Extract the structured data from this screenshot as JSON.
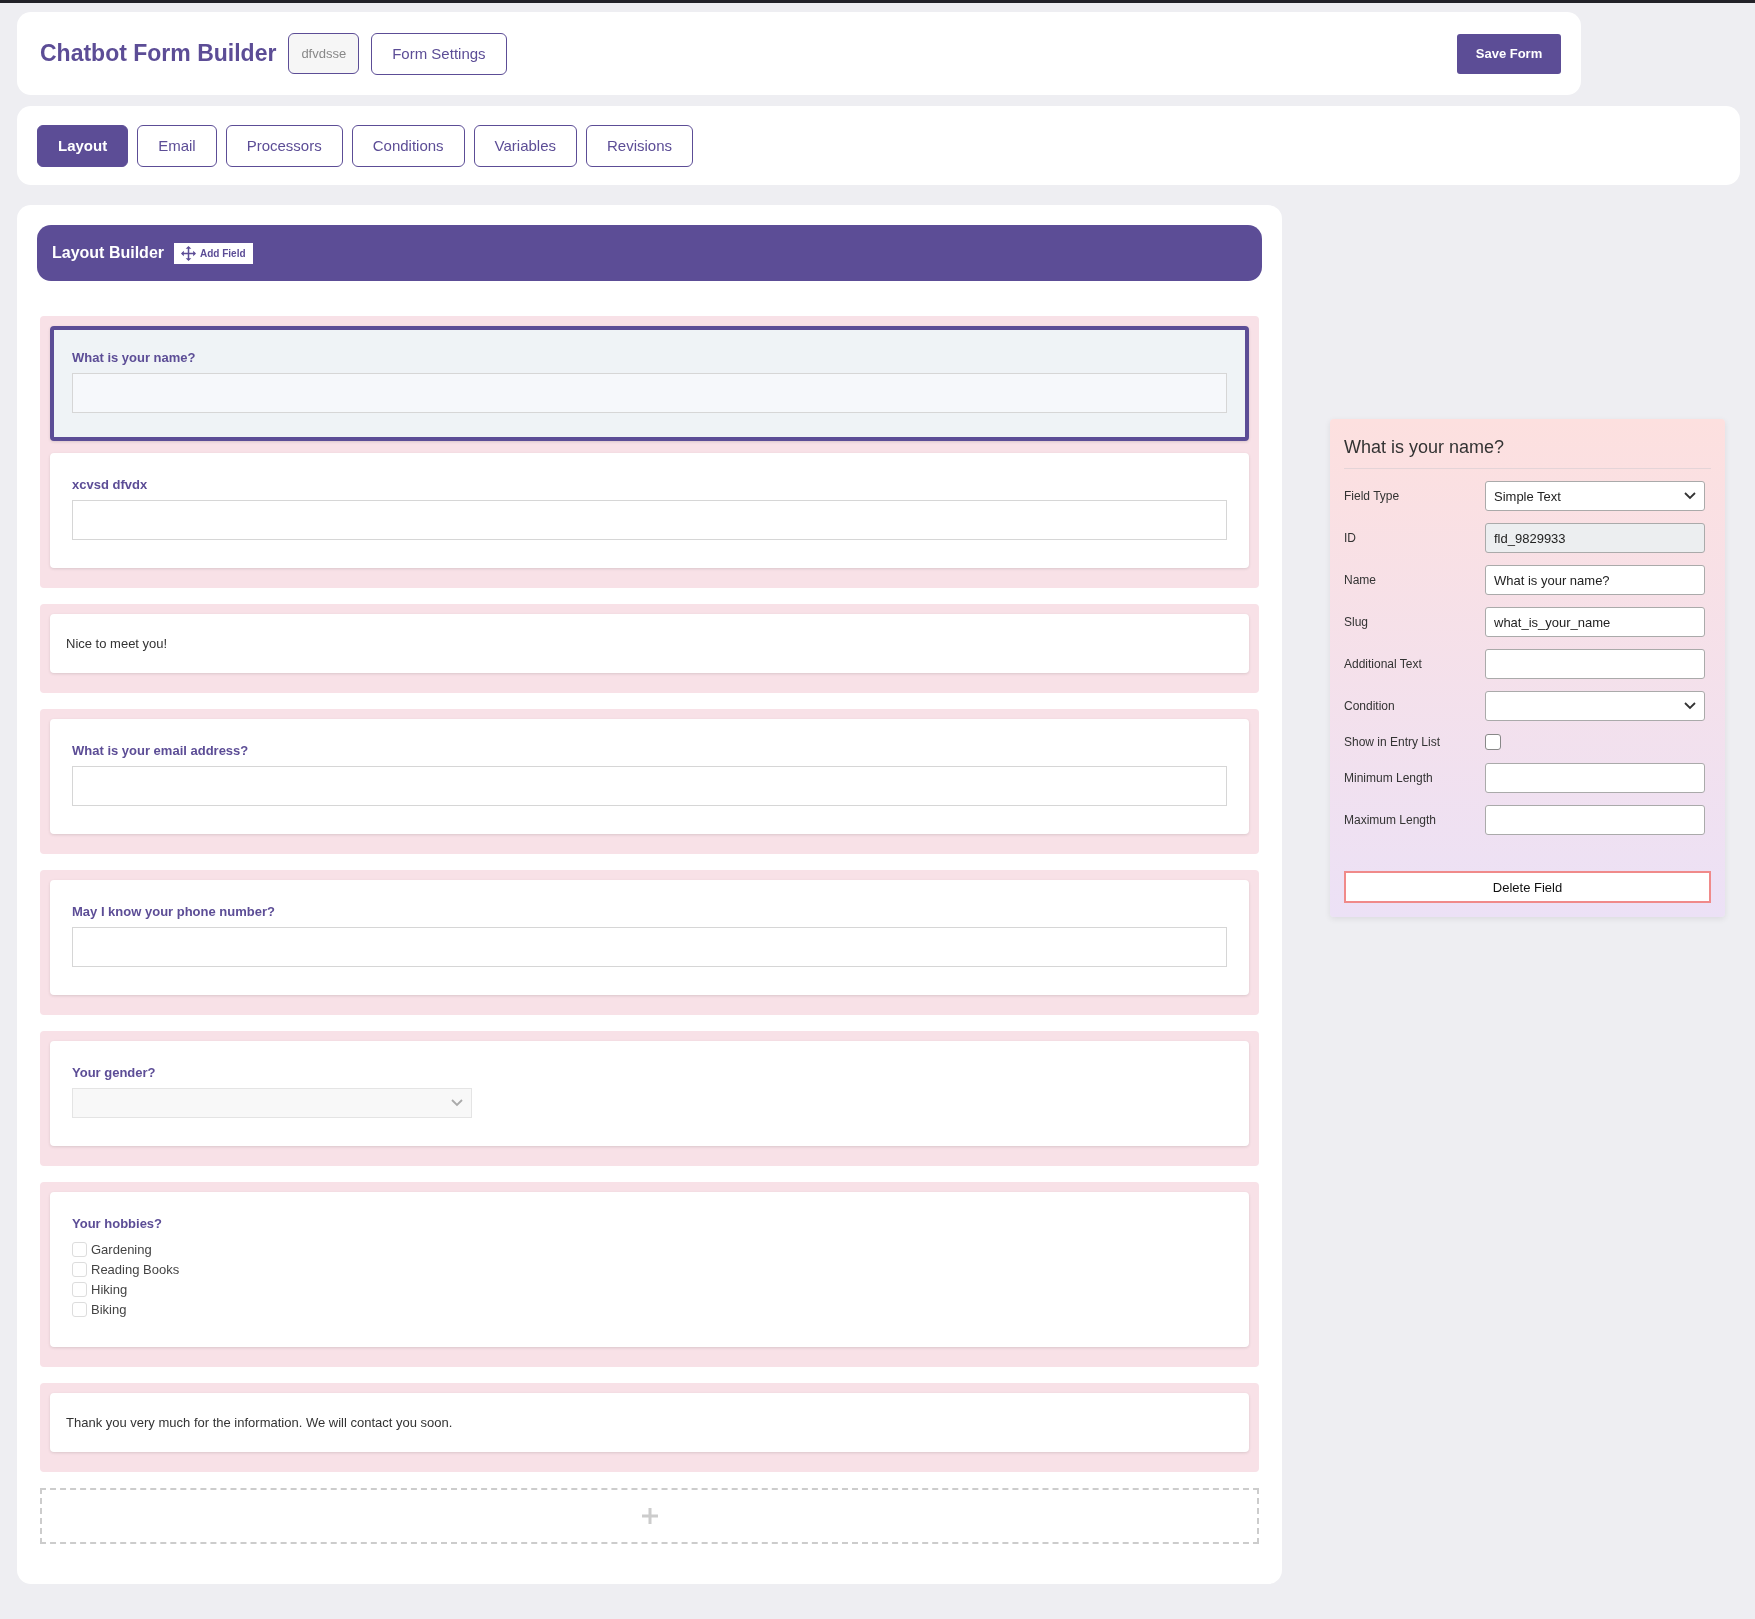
{
  "header": {
    "title": "Chatbot Form Builder",
    "form_slug": "dfvdsse",
    "settings_button": "Form Settings",
    "save_button": "Save Form"
  },
  "tabs": [
    {
      "label": "Layout",
      "selected": true
    },
    {
      "label": "Email",
      "selected": false
    },
    {
      "label": "Processors",
      "selected": false
    },
    {
      "label": "Conditions",
      "selected": false
    },
    {
      "label": "Variables",
      "selected": false
    },
    {
      "label": "Revisions",
      "selected": false
    }
  ],
  "builder": {
    "title": "Layout Builder",
    "add_button": "Add Field"
  },
  "rows": [
    {
      "fields": [
        {
          "kind": "text",
          "label": "What is your name?",
          "selected": true
        },
        {
          "kind": "text",
          "label": "xcvsd dfvdx",
          "selected": false
        }
      ]
    },
    {
      "fields": [
        {
          "kind": "html",
          "text": "Nice to meet you!",
          "selected": false
        }
      ]
    },
    {
      "fields": [
        {
          "kind": "text",
          "label": "What is your email address?",
          "selected": false
        }
      ]
    },
    {
      "fields": [
        {
          "kind": "text",
          "label": "May I know your phone number?",
          "selected": false
        }
      ]
    },
    {
      "fields": [
        {
          "kind": "select",
          "label": "Your gender?",
          "selected": false
        }
      ]
    },
    {
      "fields": [
        {
          "kind": "checkboxes",
          "label": "Your hobbies?",
          "selected": false,
          "options": [
            {
              "label": "Gardening",
              "checked": false
            },
            {
              "label": "Reading Books",
              "checked": false
            },
            {
              "label": "Hiking",
              "checked": false
            },
            {
              "label": "Biking",
              "checked": false
            }
          ]
        }
      ]
    },
    {
      "fields": [
        {
          "kind": "html",
          "text": "Thank you very much for the information. We will contact you soon.",
          "selected": false
        }
      ]
    }
  ],
  "panel": {
    "title": "What is your name?",
    "settings": [
      {
        "kind": "select",
        "label": "Field Type",
        "value": "Simple Text"
      },
      {
        "kind": "readonly",
        "label": "ID",
        "value": "fld_9829933"
      },
      {
        "kind": "input",
        "label": "Name",
        "value": "What is your name?"
      },
      {
        "kind": "input",
        "label": "Slug",
        "value": "what_is_your_name"
      },
      {
        "kind": "input",
        "label": "Additional Text"
      },
      {
        "kind": "select",
        "label": "Condition"
      },
      {
        "kind": "checkbox",
        "label": "Show in Entry List",
        "checked": false
      },
      {
        "kind": "input",
        "label": "Minimum Length"
      },
      {
        "kind": "input",
        "label": "Maximum Length"
      }
    ],
    "delete_button": "Delete Field"
  }
}
